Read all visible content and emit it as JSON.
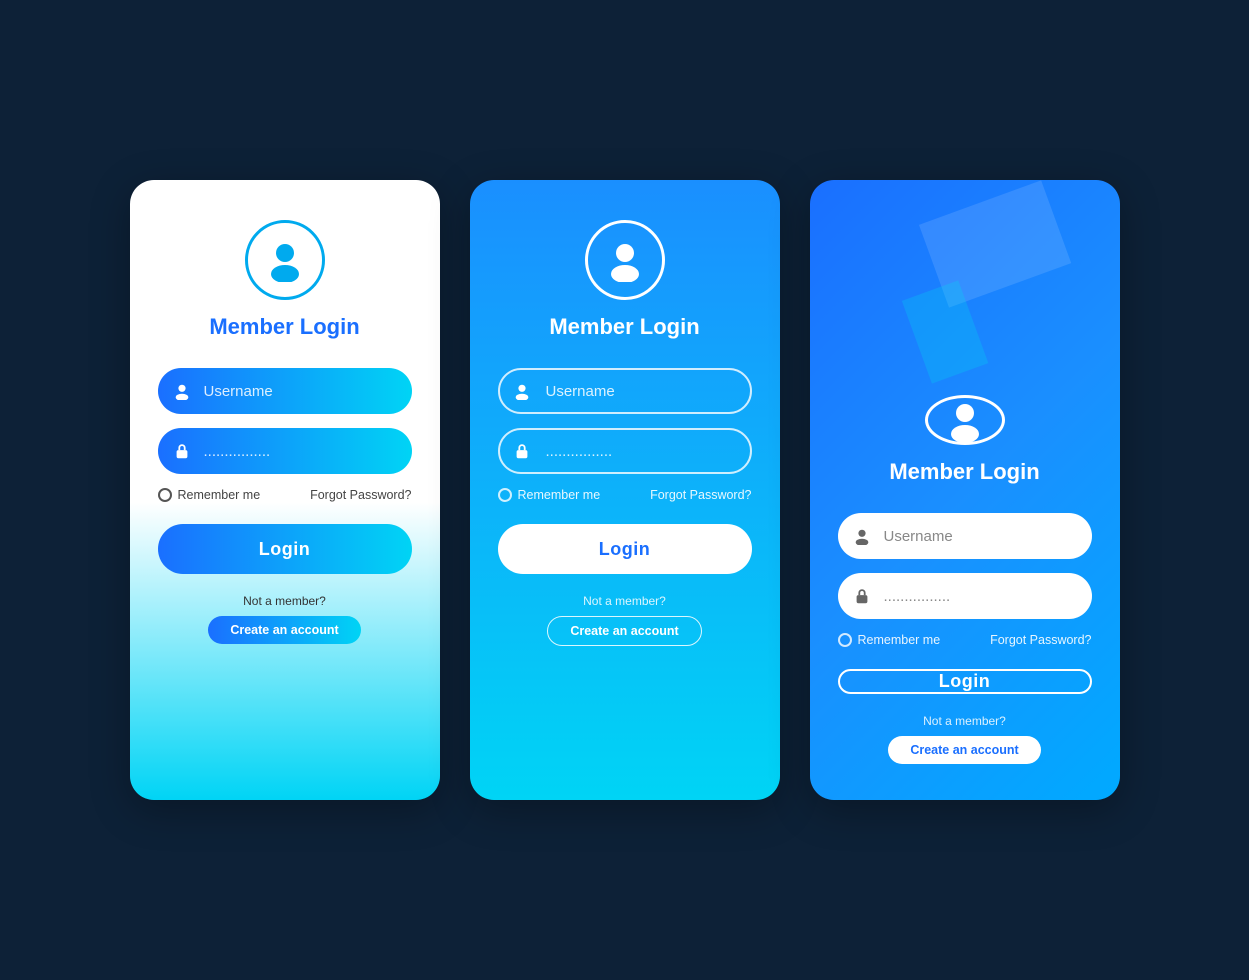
{
  "background_color": "#0d2137",
  "cards": [
    {
      "id": "card-1",
      "style": "white-gradient",
      "title": "Member Login",
      "username_placeholder": "Username",
      "password_placeholder": "................",
      "remember_label": "Remember me",
      "forgot_label": "Forgot Password?",
      "login_label": "Login",
      "not_member_label": "Not a member?",
      "create_account_label": "Create an account"
    },
    {
      "id": "card-2",
      "style": "blue-cyan-gradient",
      "title": "Member Login",
      "username_placeholder": "Username",
      "password_placeholder": "................",
      "remember_label": "Remember me",
      "forgot_label": "Forgot Password?",
      "login_label": "Login",
      "not_member_label": "Not a member?",
      "create_account_label": "Create an account"
    },
    {
      "id": "card-3",
      "style": "blue-diagonal",
      "title": "Member Login",
      "username_placeholder": "Username",
      "password_placeholder": "................",
      "remember_label": "Remember me",
      "forgot_label": "Forgot Password?",
      "login_label": "Login",
      "not_member_label": "Not a member?",
      "create_account_label": "Create an account"
    }
  ]
}
